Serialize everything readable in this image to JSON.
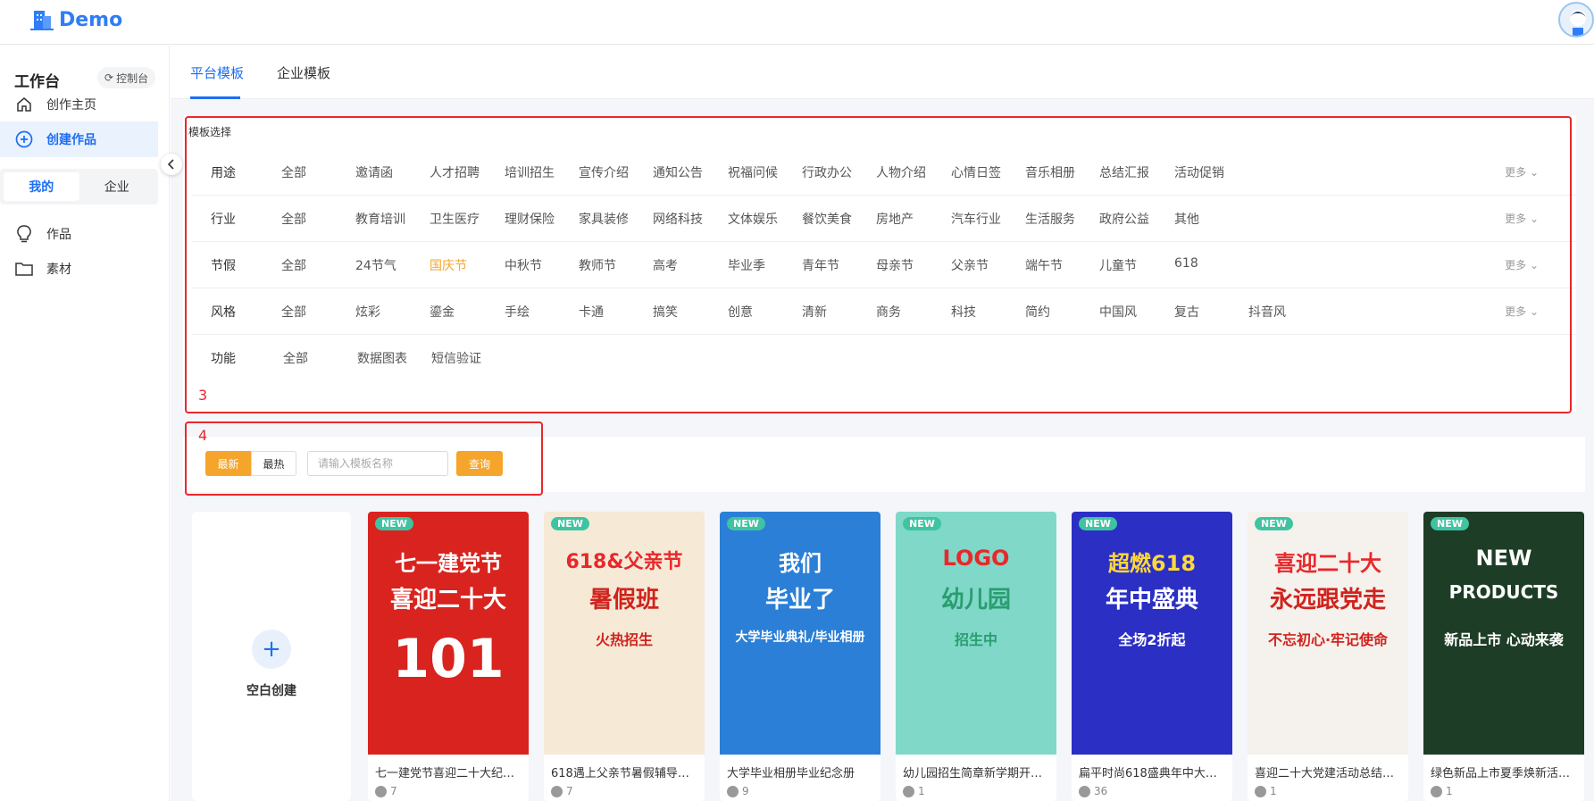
{
  "header": {
    "logo_text": "Demo"
  },
  "sidebar": {
    "workspace_title": "工作台",
    "control_btn": "控制台",
    "nav": [
      {
        "label": "创作主页",
        "icon": "home-icon"
      },
      {
        "label": "创建作品",
        "icon": "plus-circle-icon",
        "active": true
      }
    ],
    "segments": [
      "我的",
      "企业"
    ],
    "segment_active": "我的",
    "nav2": [
      {
        "label": "作品",
        "icon": "lightbulb-icon"
      },
      {
        "label": "素材",
        "icon": "folder-icon"
      }
    ]
  },
  "tabs": [
    "平台模板",
    "企业模板"
  ],
  "active_tab": "平台模板",
  "template_panel": {
    "title": "模板选择",
    "more": "更多",
    "rows": [
      {
        "label": "用途",
        "options": [
          "全部",
          "邀请函",
          "人才招聘",
          "培训招生",
          "宣传介绍",
          "通知公告",
          "祝福问候",
          "行政办公",
          "人物介绍",
          "心情日签",
          "音乐相册",
          "总结汇报",
          "活动促销"
        ]
      },
      {
        "label": "行业",
        "options": [
          "全部",
          "教育培训",
          "卫生医疗",
          "理财保险",
          "家具装修",
          "网络科技",
          "文体娱乐",
          "餐饮美食",
          "房地产",
          "汽车行业",
          "生活服务",
          "政府公益",
          "其他"
        ]
      },
      {
        "label": "节假",
        "options": [
          "全部",
          "24节气",
          "国庆节",
          "中秋节",
          "教师节",
          "高考",
          "毕业季",
          "青年节",
          "母亲节",
          "父亲节",
          "端午节",
          "儿童节",
          "618"
        ],
        "selected": "国庆节"
      },
      {
        "label": "风格",
        "options": [
          "全部",
          "炫彩",
          "鎏金",
          "手绘",
          "卡通",
          "搞笑",
          "创意",
          "清新",
          "商务",
          "科技",
          "简约",
          "中国风",
          "复古",
          "抖音风"
        ]
      },
      {
        "label": "功能",
        "options": [
          "全部",
          "数据图表",
          "短信验证"
        ]
      }
    ]
  },
  "annotations": {
    "box3": "3",
    "box4": "4"
  },
  "search": {
    "sort_new": "最新",
    "sort_hot": "最热",
    "placeholder": "请输入模板名称",
    "query_btn": "查询"
  },
  "blank_create": "空白创建",
  "badge": "NEW",
  "cards": [
    {
      "title": "七一建党节喜迎二十大纪念...",
      "count": "7",
      "poster_lines": [
        "七一建党节",
        "喜迎二十大",
        "101"
      ],
      "bg": "#d9231e"
    },
    {
      "title": "618遇上父亲节暑假辅导班课...",
      "count": "7",
      "poster_lines": [
        "618&父亲节",
        "暑假班",
        "火热招生"
      ],
      "bg": "#f6e9d6"
    },
    {
      "title": "大学毕业相册毕业纪念册",
      "count": "9",
      "poster_lines": [
        "我们",
        "毕业了",
        "大学毕业典礼/毕业相册"
      ],
      "bg": "#2b7fd6"
    },
    {
      "title": "幼儿园招生简章新学期开学...",
      "count": "1",
      "poster_lines": [
        "LOGO",
        "幼儿园",
        "招生中"
      ],
      "bg": "#7fd8c8"
    },
    {
      "title": "扁平时尚618盛典年中大促店...",
      "count": "36",
      "poster_lines": [
        "超燃618",
        "年中盛典",
        "全场2折起"
      ],
      "bg": "#2b2fc4"
    },
    {
      "title": "喜迎二十大党建活动总结回...",
      "count": "1",
      "poster_lines": [
        "喜迎二十大",
        "永远跟党走",
        "不忘初心·牢记使命"
      ],
      "bg": "#f5f1ec"
    },
    {
      "title": "绿色新品上市夏季焕新活动...",
      "count": "1",
      "poster_lines": [
        "NEW",
        "PRODUCTS",
        "新品上市 心动来袭"
      ],
      "bg": "#1e3d26"
    }
  ]
}
